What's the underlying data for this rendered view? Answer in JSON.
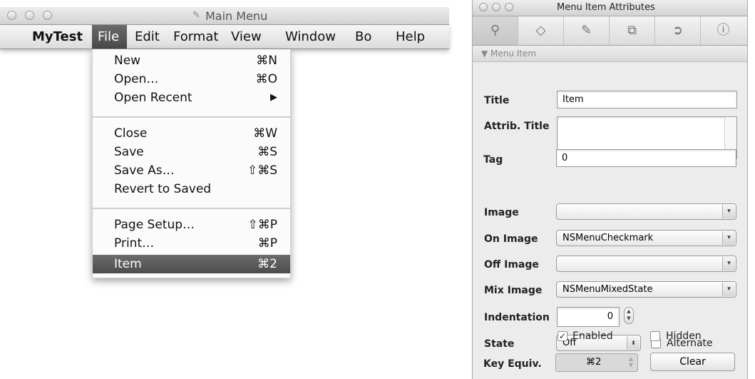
{
  "main_menu_window": {
    "title": "Main Menu",
    "menubar": [
      "MyTest",
      "File",
      "Edit",
      "Format",
      "View",
      "Window",
      "Bo",
      "Help"
    ],
    "active_menu": "File"
  },
  "file_menu": {
    "items": [
      {
        "label": "New",
        "shortcut": "⌘N"
      },
      {
        "label": "Open…",
        "shortcut": "⌘O"
      },
      {
        "label": "Open Recent",
        "shortcut": "▶"
      },
      {
        "label": "Close",
        "shortcut": "⌘W"
      },
      {
        "label": "Save",
        "shortcut": "⌘S"
      },
      {
        "label": "Save As…",
        "shortcut": "⇧⌘S"
      },
      {
        "label": "Revert to Saved",
        "shortcut": ""
      },
      {
        "label": "Page Setup…",
        "shortcut": "⇧⌘P"
      },
      {
        "label": "Print…",
        "shortcut": "⌘P"
      },
      {
        "label": "Item",
        "shortcut": "⌘2"
      }
    ],
    "selected": "Item"
  },
  "inspector": {
    "title": "Menu Item Attributes",
    "section": "Menu Item",
    "tab_icons": [
      "attributes-icon",
      "effects-icon",
      "size-ruler-icon",
      "bindings-icon",
      "connections-icon",
      "info-icon"
    ],
    "fields": {
      "title_label": "Title",
      "title_value": "Item",
      "attrib_title_label": "Attrib. Title",
      "attrib_title_value": "",
      "tag_label": "Tag",
      "tag_value": "0",
      "image_label": "Image",
      "image_value": "",
      "on_image_label": "On Image",
      "on_image_value": "NSMenuCheckmark",
      "off_image_label": "Off Image",
      "off_image_value": "",
      "mix_image_label": "Mix Image",
      "mix_image_value": "NSMenuMixedState",
      "indentation_label": "Indentation",
      "indentation_value": "0",
      "state_label": "State",
      "state_value": "Off",
      "alternate_label": "Alternate",
      "alternate_checked": false,
      "enabled_label": "Enabled",
      "enabled_checked": true,
      "hidden_label": "Hidden",
      "hidden_checked": false,
      "key_equiv_label": "Key Equiv.",
      "key_equiv_value": "⌘2",
      "clear_label": "Clear"
    }
  },
  "colors": {
    "selection": "#5a5a5a",
    "window_bg": "#e6e6e6"
  }
}
